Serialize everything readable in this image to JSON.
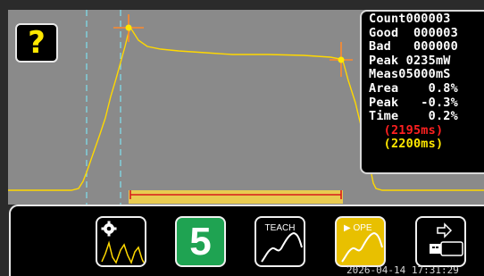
{
  "help_button": {
    "label": "?"
  },
  "stats": [
    {
      "text": "Count000003",
      "tone": "white"
    },
    {
      "text": "Good  000003",
      "tone": "white"
    },
    {
      "text": "Bad   000000",
      "tone": "white"
    },
    {
      "text": "Peak 0235mW",
      "tone": "white"
    },
    {
      "text": "Meas05000mS",
      "tone": "white"
    },
    {
      "text": "Area    0.8%",
      "tone": "white"
    },
    {
      "text": "Peak   -0.3%",
      "tone": "white"
    },
    {
      "text": "Time    0.2%",
      "tone": "white"
    },
    {
      "text": "  (2195ms)",
      "tone": "red"
    },
    {
      "text": "  (2200ms)",
      "tone": "yellow"
    }
  ],
  "toolbar": {
    "settings_button": {
      "icon": "gear-waveform-icon"
    },
    "channel_button": {
      "label": "5"
    },
    "teach_button": {
      "label": "TEACH"
    },
    "ope_button": {
      "label": "▶ OPE"
    },
    "export_button": {
      "icon": "arrow-to-usb-icon"
    }
  },
  "timestamp": "2026-04-14 17:31:29",
  "colors": {
    "plot_bg": "#8a8a8a",
    "waveform": "#ffd800",
    "cursor_lines": "#7fe0f0",
    "limit_band": "#d81b1b",
    "marker": "#ff8a2a"
  }
}
